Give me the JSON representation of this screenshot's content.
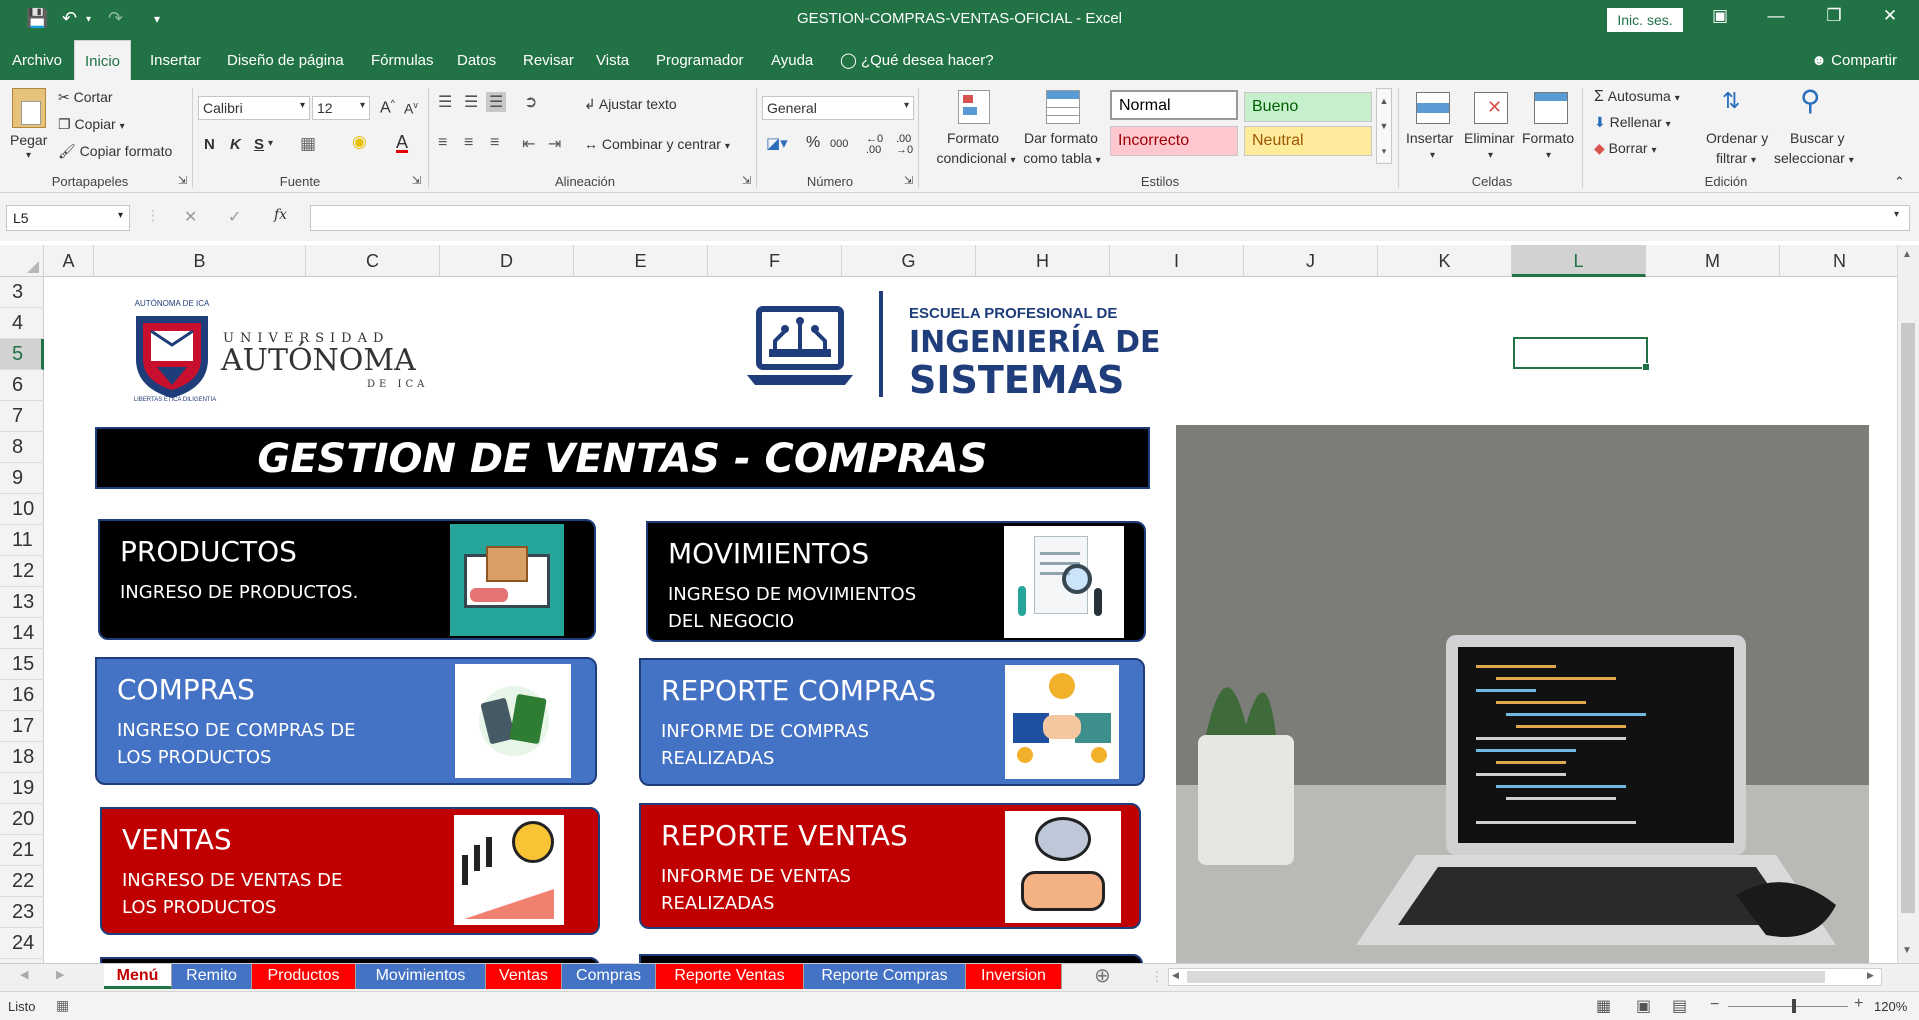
{
  "app": {
    "window_title": "GESTION-COMPRAS-VENTAS-OFICIAL  -  Excel",
    "sign_in": "Inic. ses.",
    "share": "Compartir"
  },
  "tabs": [
    "Archivo",
    "Inicio",
    "Insertar",
    "Diseño de página",
    "Fórmulas",
    "Datos",
    "Revisar",
    "Vista",
    "Programador",
    "Ayuda"
  ],
  "tell_me": "¿Qué desea hacer?",
  "ribbon": {
    "clipboard": {
      "paste": "Pegar",
      "cut": "Cortar",
      "copy": "Copiar",
      "format_painter": "Copiar formato",
      "label": "Portapapeles"
    },
    "font": {
      "name": "Calibri",
      "size": "12",
      "bold": "N",
      "italic": "K",
      "underline": "S",
      "label": "Fuente"
    },
    "alignment": {
      "wrap": "Ajustar texto",
      "merge": "Combinar y centrar",
      "label": "Alineación"
    },
    "number": {
      "format": "General",
      "label": "Número"
    },
    "styles": {
      "cond_format_1": "Formato",
      "cond_format_2": "condicional",
      "table_1": "Dar formato",
      "table_2": "como tabla",
      "normal": "Normal",
      "good": "Bueno",
      "bad": "Incorrecto",
      "neutral": "Neutral",
      "label": "Estilos"
    },
    "cells": {
      "insert": "Insertar",
      "delete": "Eliminar",
      "format": "Formato",
      "label": "Celdas"
    },
    "editing": {
      "autosum": "Autosuma",
      "fill": "Rellenar",
      "clear": "Borrar",
      "sort_1": "Ordenar y",
      "sort_2": "filtrar",
      "find_1": "Buscar y",
      "find_2": "seleccionar",
      "label": "Edición"
    }
  },
  "formula_bar": {
    "name_box": "L5",
    "fx": "fx",
    "value": ""
  },
  "columns": [
    "A",
    "B",
    "C",
    "D",
    "E",
    "F",
    "G",
    "H",
    "I",
    "J",
    "K",
    "L",
    "M",
    "N"
  ],
  "rows": [
    "3",
    "4",
    "5",
    "6",
    "7",
    "8",
    "9",
    "10",
    "11",
    "12",
    "13",
    "14",
    "15",
    "16",
    "17",
    "18",
    "19",
    "20",
    "21",
    "22",
    "23",
    "24"
  ],
  "sheet": {
    "uni_small": "AUTÓNOMA DE ICA",
    "uni_top": "UNIVERSIDAD",
    "uni_main": "AUTÓNOMA",
    "uni_bottom": "DE ICA",
    "seal_text": "LIBERTAS ETICA DILIGENTIA",
    "school_1": "ESCUELA PROFESIONAL DE",
    "school_2": "INGENIERÍA DE",
    "school_3": "SISTEMAS",
    "banner": "GESTION DE VENTAS - COMPRAS",
    "cards": [
      {
        "title": "PRODUCTOS",
        "line1": "INGRESO DE PRODUCTOS.",
        "line2": ""
      },
      {
        "title": "MOVIMIENTOS",
        "line1": "INGRESO DE MOVIMIENTOS",
        "line2": "DEL NEGOCIO"
      },
      {
        "title": "COMPRAS",
        "line1": "INGRESO DE COMPRAS DE",
        "line2": "LOS PRODUCTOS"
      },
      {
        "title": "REPORTE COMPRAS",
        "line1": "INFORME DE COMPRAS",
        "line2": "REALIZADAS"
      },
      {
        "title": "VENTAS",
        "line1": "INGRESO DE VENTAS DE",
        "line2": "LOS PRODUCTOS"
      },
      {
        "title": "REPORTE VENTAS",
        "line1": "INFORME DE VENTAS",
        "line2": "REALIZADAS"
      }
    ]
  },
  "sheet_tabs": [
    {
      "label": "Menú",
      "color": "#ffffff"
    },
    {
      "label": "Remito",
      "color": "#4472c4"
    },
    {
      "label": "Productos",
      "color": "#ff0000"
    },
    {
      "label": "Movimientos",
      "color": "#4472c4"
    },
    {
      "label": "Ventas",
      "color": "#ff0000"
    },
    {
      "label": "Compras",
      "color": "#4472c4"
    },
    {
      "label": "Reporte Ventas",
      "color": "#ff0000"
    },
    {
      "label": "Reporte Compras",
      "color": "#4472c4"
    },
    {
      "label": "Inversion",
      "color": "#ff0000"
    }
  ],
  "status": {
    "mode": "Listo",
    "zoom": "120%"
  },
  "colors": {
    "excel_green": "#217346",
    "navy": "#1f3d7a",
    "blue": "#4472c4",
    "red": "#c00000"
  }
}
